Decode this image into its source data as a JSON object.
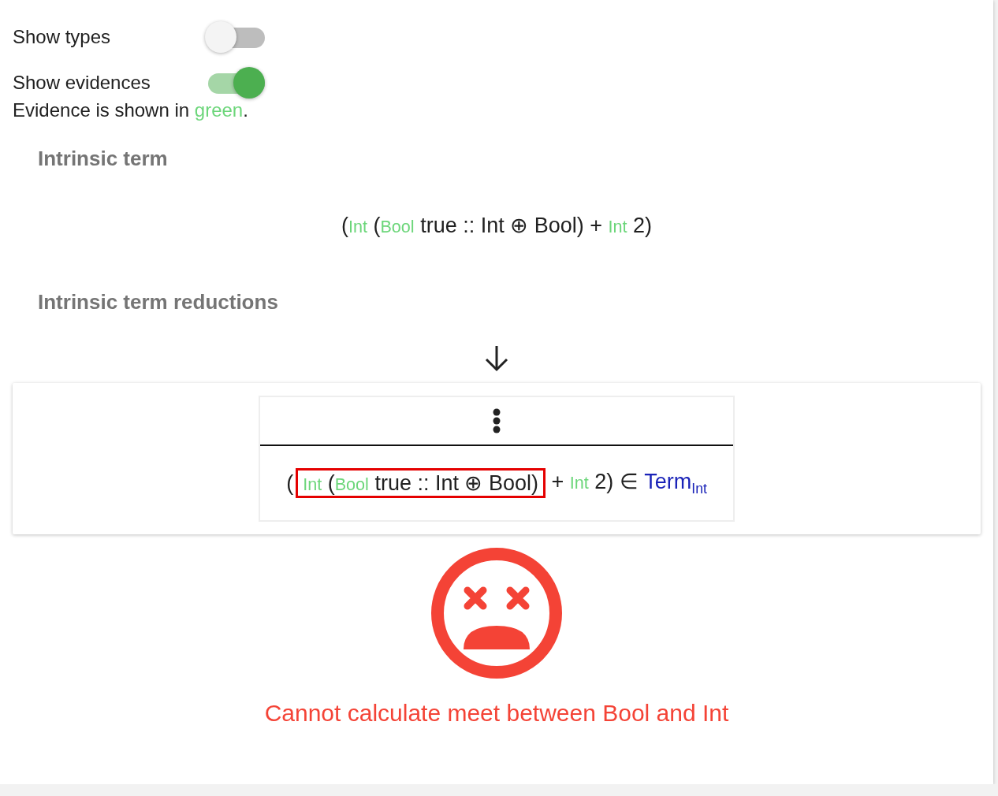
{
  "toggles": [
    {
      "label": "Show types",
      "on": false
    },
    {
      "label": "Show evidences",
      "on": true
    }
  ],
  "note": [
    {
      "text": "Evidence is shown in ",
      "kind": "plain"
    },
    {
      "text": "green",
      "kind": "evidence"
    },
    {
      "text": ".",
      "kind": "plain"
    }
  ],
  "sections": [
    {
      "heading": "Intrinsic term",
      "formula": [
        {
          "text": "(",
          "kind": "plain"
        },
        {
          "text": "Int",
          "kind": "evidence"
        },
        {
          "text": " (",
          "kind": "plain"
        },
        {
          "text": "Bool",
          "kind": "evidence"
        },
        {
          "text": " true :: Int ⊕ Bool) + ",
          "kind": "plain"
        },
        {
          "text": "Int",
          "kind": "evidence"
        },
        {
          "text": " 2)",
          "kind": "plain"
        }
      ]
    },
    {
      "heading": "Intrinsic term reductions"
    }
  ],
  "derivation": {
    "conclusion": [
      {
        "kind": "plain",
        "runs": [
          {
            "text": "(",
            "kind": "plain"
          }
        ]
      },
      {
        "kind": "highlight",
        "runs": [
          {
            "text": "Int",
            "kind": "evidence"
          },
          {
            "text": " (",
            "kind": "plain"
          },
          {
            "text": "Bool",
            "kind": "evidence"
          },
          {
            "text": " true :: Int ⊕ Bool)",
            "kind": "plain"
          }
        ]
      },
      {
        "kind": "plain",
        "runs": [
          {
            "text": " + ",
            "kind": "plain"
          },
          {
            "text": "Int",
            "kind": "evidence"
          },
          {
            "text": " 2) ∈ ",
            "kind": "plain"
          },
          {
            "text": "Term",
            "kind": "type"
          },
          {
            "text": "Int",
            "kind": "subscript"
          }
        ]
      }
    ]
  },
  "error": {
    "message": "Cannot calculate meet between Bool and Int"
  }
}
